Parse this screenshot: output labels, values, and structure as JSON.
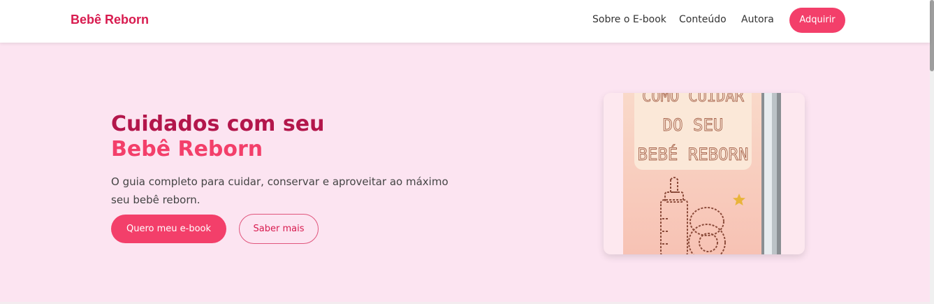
{
  "nav": {
    "brand": "Bebê Reborn",
    "links": [
      "Sobre o E-book",
      "Conteúdo",
      "Autora"
    ],
    "cta": "Adquirir"
  },
  "hero": {
    "title_line1": "Cuidados com seu",
    "title_line2": "Bebê Reborn",
    "description": "O guia completo para cuidar, conservar e aproveitar ao máximo seu bebê reborn.",
    "primary_button": "Quero meu e-book",
    "secondary_button": "Saber mais"
  },
  "book_cover": {
    "line1": "COMO CUIDAR",
    "line2": "DO SEU",
    "line3": "BEBÉ REBORN"
  },
  "colors": {
    "brand": "#d81b4f",
    "accent": "#f33f6a",
    "hero_bg": "#fce4f1"
  },
  "icons": [
    "baby-bottle-icon",
    "pacifier-icon",
    "star-icon"
  ]
}
